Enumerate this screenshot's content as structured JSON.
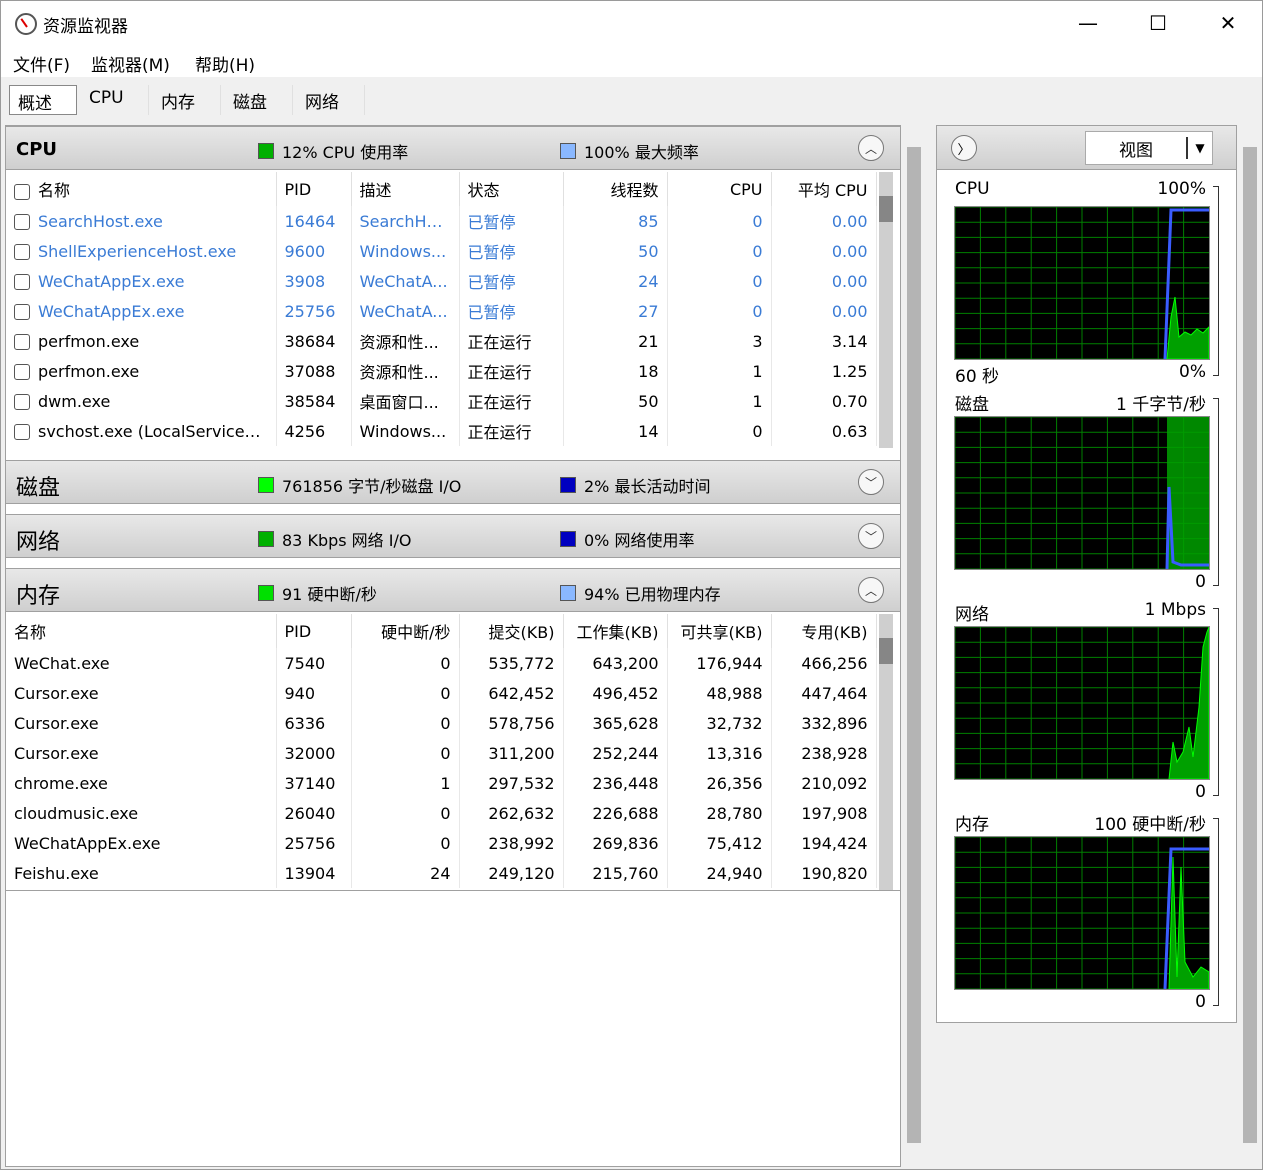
{
  "window": {
    "title": "资源监视器",
    "controls": {
      "minimize": "—",
      "maximize": "☐",
      "close": "✕"
    }
  },
  "menu": [
    "文件(F)",
    "监视器(M)",
    "帮助(H)"
  ],
  "tabs": [
    {
      "label": "概述",
      "active": true
    },
    {
      "label": "CPU",
      "active": false
    },
    {
      "label": "内存",
      "active": false
    },
    {
      "label": "磁盘",
      "active": false
    },
    {
      "label": "网络",
      "active": false
    }
  ],
  "cpu": {
    "title": "CPU",
    "legend1": {
      "text": "12% CPU 使用率",
      "color": "#00b000"
    },
    "legend2": {
      "text": "100% 最大频率",
      "color": "#8ab8ff"
    },
    "columns": [
      "名称",
      "PID",
      "描述",
      "状态",
      "线程数",
      "CPU",
      "平均 CPU"
    ],
    "rows": [
      {
        "name": "SearchHost.exe",
        "pid": "16464",
        "desc": "SearchHo...",
        "status": "已暂停",
        "threads": "85",
        "cpu": "0",
        "avg": "0.00",
        "paused": true
      },
      {
        "name": "ShellExperienceHost.exe",
        "pid": "9600",
        "desc": "Windows...",
        "status": "已暂停",
        "threads": "50",
        "cpu": "0",
        "avg": "0.00",
        "paused": true
      },
      {
        "name": "WeChatAppEx.exe",
        "pid": "3908",
        "desc": "WeChatA...",
        "status": "已暂停",
        "threads": "24",
        "cpu": "0",
        "avg": "0.00",
        "paused": true
      },
      {
        "name": "WeChatAppEx.exe",
        "pid": "25756",
        "desc": "WeChatA...",
        "status": "已暂停",
        "threads": "27",
        "cpu": "0",
        "avg": "0.00",
        "paused": true
      },
      {
        "name": "perfmon.exe",
        "pid": "38684",
        "desc": "资源和性...",
        "status": "正在运行",
        "threads": "21",
        "cpu": "3",
        "avg": "3.14",
        "paused": false
      },
      {
        "name": "perfmon.exe",
        "pid": "37088",
        "desc": "资源和性...",
        "status": "正在运行",
        "threads": "18",
        "cpu": "1",
        "avg": "1.25",
        "paused": false
      },
      {
        "name": "dwm.exe",
        "pid": "38584",
        "desc": "桌面窗口...",
        "status": "正在运行",
        "threads": "50",
        "cpu": "1",
        "avg": "0.70",
        "paused": false
      },
      {
        "name": "svchost.exe (LocalServiceNo...",
        "pid": "4256",
        "desc": "Windows...",
        "status": "正在运行",
        "threads": "14",
        "cpu": "0",
        "avg": "0.63",
        "paused": false
      }
    ]
  },
  "disk": {
    "title": "磁盘",
    "legend1": {
      "text": "761856 字节/秒磁盘 I/O",
      "color": "#00ff00"
    },
    "legend2": {
      "text": "2% 最长活动时间",
      "color": "#0000c0"
    }
  },
  "network": {
    "title": "网络",
    "legend1": {
      "text": "83 Kbps 网络 I/O",
      "color": "#00b000"
    },
    "legend2": {
      "text": "0% 网络使用率",
      "color": "#0000c0"
    }
  },
  "memory": {
    "title": "内存",
    "legend1": {
      "text": "91 硬中断/秒",
      "color": "#00e000"
    },
    "legend2": {
      "text": "94% 已用物理内存",
      "color": "#8ab8ff"
    },
    "columns": [
      "名称",
      "PID",
      "硬中断/秒",
      "提交(KB)",
      "工作集(KB)",
      "可共享(KB)",
      "专用(KB)"
    ],
    "rows": [
      {
        "name": "WeChat.exe",
        "pid": "7540",
        "hf": "0",
        "commit": "535,772",
        "ws": "643,200",
        "share": "176,944",
        "priv": "466,256"
      },
      {
        "name": "Cursor.exe",
        "pid": "940",
        "hf": "0",
        "commit": "642,452",
        "ws": "496,452",
        "share": "48,988",
        "priv": "447,464"
      },
      {
        "name": "Cursor.exe",
        "pid": "6336",
        "hf": "0",
        "commit": "578,756",
        "ws": "365,628",
        "share": "32,732",
        "priv": "332,896"
      },
      {
        "name": "Cursor.exe",
        "pid": "32000",
        "hf": "0",
        "commit": "311,200",
        "ws": "252,244",
        "share": "13,316",
        "priv": "238,928"
      },
      {
        "name": "chrome.exe",
        "pid": "37140",
        "hf": "1",
        "commit": "297,532",
        "ws": "236,448",
        "share": "26,356",
        "priv": "210,092"
      },
      {
        "name": "cloudmusic.exe",
        "pid": "26040",
        "hf": "0",
        "commit": "262,632",
        "ws": "226,688",
        "share": "28,780",
        "priv": "197,908"
      },
      {
        "name": "WeChatAppEx.exe",
        "pid": "25756",
        "hf": "0",
        "commit": "238,992",
        "ws": "269,836",
        "share": "75,412",
        "priv": "194,424"
      },
      {
        "name": "Feishu.exe",
        "pid": "13904",
        "hf": "24",
        "commit": "249,120",
        "ws": "215,760",
        "share": "24,940",
        "priv": "190,820"
      }
    ]
  },
  "right": {
    "view_label": "视图",
    "graphs": [
      {
        "title": "CPU",
        "max": "100%",
        "time": "60 秒",
        "min": "0%"
      },
      {
        "title": "磁盘",
        "max": "1 千字节/秒",
        "min": "0"
      },
      {
        "title": "网络",
        "max": "1 Mbps",
        "min": "0"
      },
      {
        "title": "内存",
        "max": "100 硬中断/秒",
        "min": "0"
      }
    ]
  }
}
